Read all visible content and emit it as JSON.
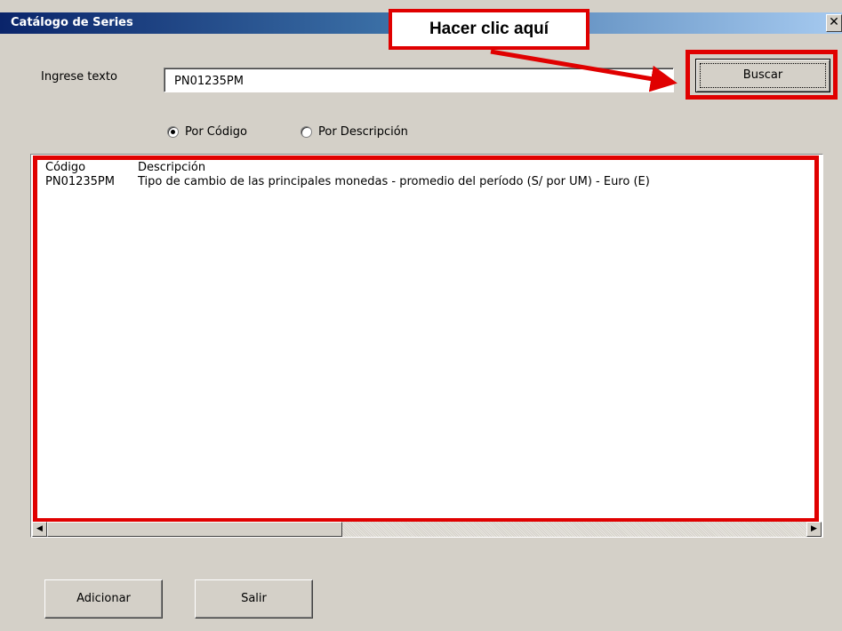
{
  "window": {
    "title": "Catálogo de Series",
    "close_glyph": "✕"
  },
  "search": {
    "label": "Ingrese texto",
    "value": "PN01235PM",
    "button_label": "Buscar"
  },
  "callout": {
    "text": "Hacer clic aquí"
  },
  "radios": [
    {
      "label": "Por Código",
      "checked": true
    },
    {
      "label": "Por Descripción",
      "checked": false
    }
  ],
  "results": {
    "header": {
      "code": "Código",
      "description": "Descripción"
    },
    "rows": [
      {
        "code": "PN01235PM",
        "description": "Tipo de cambio de las principales monedas - promedio del período (S/ por UM) - Euro (E)"
      }
    ]
  },
  "footer": {
    "add_label": "Adicionar",
    "exit_label": "Salir"
  },
  "colors": {
    "highlight": "#e00000",
    "title_gradient_start": "#0a246a",
    "dialog_bg": "#d4d0c8"
  },
  "icons": {
    "scroll_left": "◀",
    "scroll_right": "▶"
  }
}
